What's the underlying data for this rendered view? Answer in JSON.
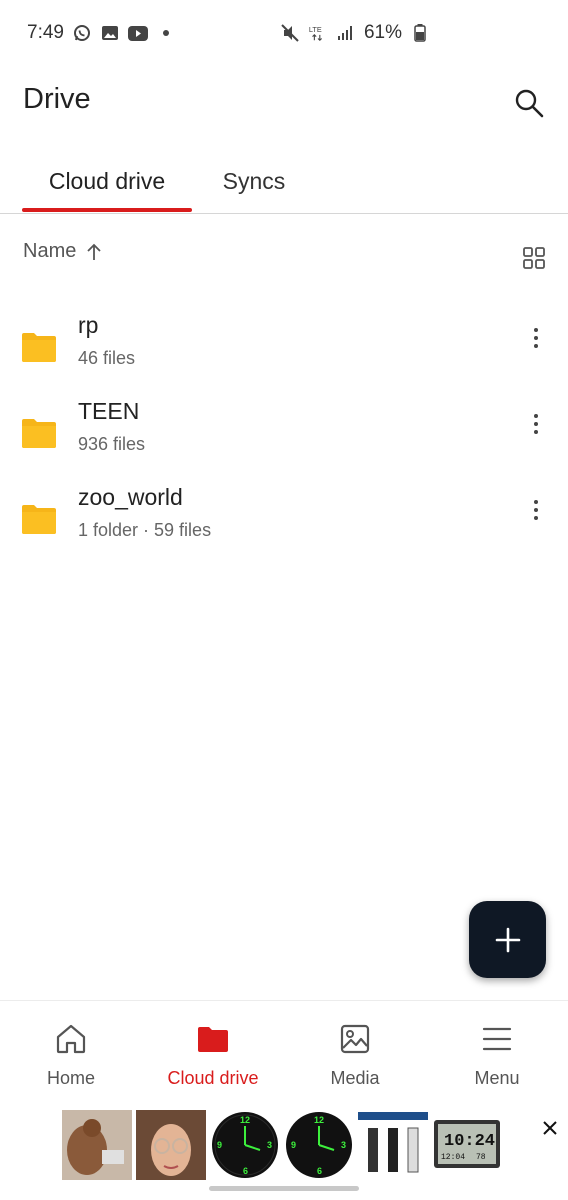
{
  "status_bar": {
    "time": "7:49",
    "battery": "61%",
    "network": "LTE"
  },
  "header": {
    "title": "Drive"
  },
  "tabs": [
    {
      "label": "Cloud drive",
      "active": true
    },
    {
      "label": "Syncs",
      "active": false
    }
  ],
  "sort": {
    "label": "Name",
    "direction_icon": "arrow-up-icon"
  },
  "files": [
    {
      "name": "rp",
      "meta": "46 files",
      "icon": "folder-icon"
    },
    {
      "name": "TEEN",
      "meta": "936 files",
      "icon": "folder-icon"
    },
    {
      "name": "zoo_world",
      "meta": "1 folder · 59 files",
      "icon": "folder-icon"
    }
  ],
  "bottom_nav": [
    {
      "label": "Home",
      "icon": "home-icon",
      "active": false
    },
    {
      "label": "Cloud drive",
      "icon": "folder-icon",
      "active": true
    },
    {
      "label": "Media",
      "icon": "image-icon",
      "active": false
    },
    {
      "label": "Menu",
      "icon": "menu-icon",
      "active": false
    }
  ],
  "ad": {
    "clock_digital": "10:24",
    "clock_date": "12:04",
    "clock_temp": "78"
  },
  "colors": {
    "accent": "#d91c1c",
    "folder": "#f6b519",
    "fab": "#0f1825"
  }
}
